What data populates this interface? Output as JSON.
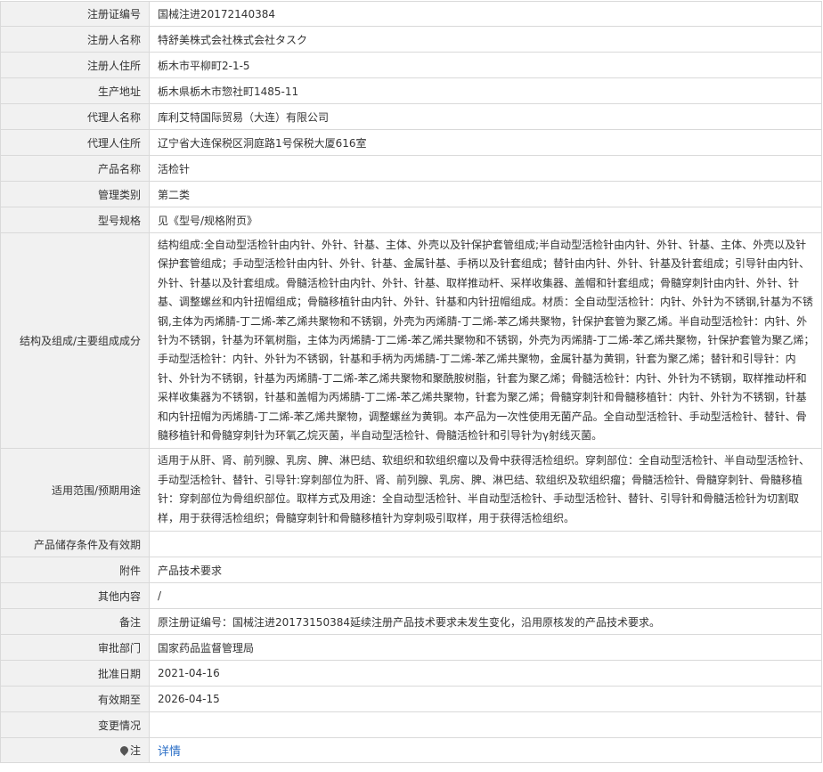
{
  "rows": [
    {
      "label": "注册证编号",
      "value": "国械注进20172140384"
    },
    {
      "label": "注册人名称",
      "value": "特舒美株式会社株式会社タスク"
    },
    {
      "label": "注册人住所",
      "value": "栃木市平柳町2-1-5"
    },
    {
      "label": "生产地址",
      "value": "栃木県栃木市惣社町1485-11"
    },
    {
      "label": "代理人名称",
      "value": "库利艾特国际贸易（大连）有限公司"
    },
    {
      "label": "代理人住所",
      "value": "辽宁省大连保税区洞庭路1号保税大厦616室"
    },
    {
      "label": "产品名称",
      "value": "活检针"
    },
    {
      "label": "管理类别",
      "value": "第二类"
    },
    {
      "label": "型号规格",
      "value": "见《型号/规格附页》"
    },
    {
      "label": "结构及组成/主要组成成分",
      "value": "结构组成:全自动型活检针由内针、外针、针基、主体、外壳以及针保护套管组成;半自动型活检针由内针、外针、针基、主体、外壳以及针保护套管组成；手动型活检针由内针、外针、针基、金属针基、手柄以及针套组成；替针由内针、外针、针基及针套组成；引导针由内针、外针、针基以及针套组成。骨髓活检针由内针、外针、针基、取样推动杆、采样收集器、盖帽和针套组成；骨髓穿刺针由内针、外针、针基、调整螺丝和内针扭帽组成；骨髓移植针由内针、外针、针基和内针扭帽组成。材质：全自动型活检针：内针、外针为不锈钢,针基为不锈钢,主体为丙烯腈-丁二烯-苯乙烯共聚物和不锈钢，外壳为丙烯腈-丁二烯-苯乙烯共聚物，针保护套管为聚乙烯。半自动型活检针：内针、外针为不锈钢，针基为环氧树脂，主体为丙烯腈-丁二烯-苯乙烯共聚物和不锈钢，外壳为丙烯腈-丁二烯-苯乙烯共聚物，针保护套管为聚乙烯；手动型活检针：内针、外针为不锈钢，针基和手柄为丙烯腈-丁二烯-苯乙烯共聚物，金属针基为黄铜，针套为聚乙烯；替针和引导针：内针、外针为不锈钢，针基为丙烯腈-丁二烯-苯乙烯共聚物和聚酰胺树脂，针套为聚乙烯；骨髓活检针：内针、外针为不锈钢，取样推动杆和采样收集器为不锈钢，针基和盖帽为丙烯腈-丁二烯-苯乙烯共聚物，针套为聚乙烯；骨髓穿刺针和骨髓移植针：内针、外针为不锈钢，针基和内针扭帽为丙烯腈-丁二烯-苯乙烯共聚物，调整螺丝为黄铜。本产品为一次性使用无菌产品。全自动型活检针、手动型活检针、替针、骨髓移植针和骨髓穿刺针为环氧乙烷灭菌，半自动型活检针、骨髓活检针和引导针为γ射线灭菌。"
    },
    {
      "label": "适用范围/预期用途",
      "value": "适用于从肝、肾、前列腺、乳房、脾、淋巴结、软组织和软组织瘤以及骨中获得活检组织。穿刺部位：全自动型活检针、半自动型活检针、手动型活检针、替针、引导针:穿刺部位为肝、肾、前列腺、乳房、脾、淋巴结、软组织及软组织瘤；骨髓活检针、骨髓穿刺针、骨髓移植针：穿刺部位为骨组织部位。取样方式及用途：全自动型活检针、半自动型活检针、手动型活检针、替针、引导针和骨髓活检针为切割取样，用于获得活检组织；骨髓穿刺针和骨髓移植针为穿刺吸引取样，用于获得活检组织。"
    },
    {
      "label": "产品储存条件及有效期",
      "value": ""
    },
    {
      "label": "附件",
      "value": "产品技术要求"
    },
    {
      "label": "其他内容",
      "value": "/"
    },
    {
      "label": "备注",
      "value": "原注册证编号：国械注进20173150384延续注册产品技术要求未发生变化，沿用原核发的产品技术要求。"
    },
    {
      "label": "审批部门",
      "value": "国家药品监督管理局"
    },
    {
      "label": "批准日期",
      "value": "2021-04-16"
    },
    {
      "label": "有效期至",
      "value": "2026-04-15"
    },
    {
      "label": "变更情况",
      "value": ""
    }
  ],
  "note": {
    "label": "注",
    "link_text": "详情",
    "icon": "map-pin-icon"
  }
}
